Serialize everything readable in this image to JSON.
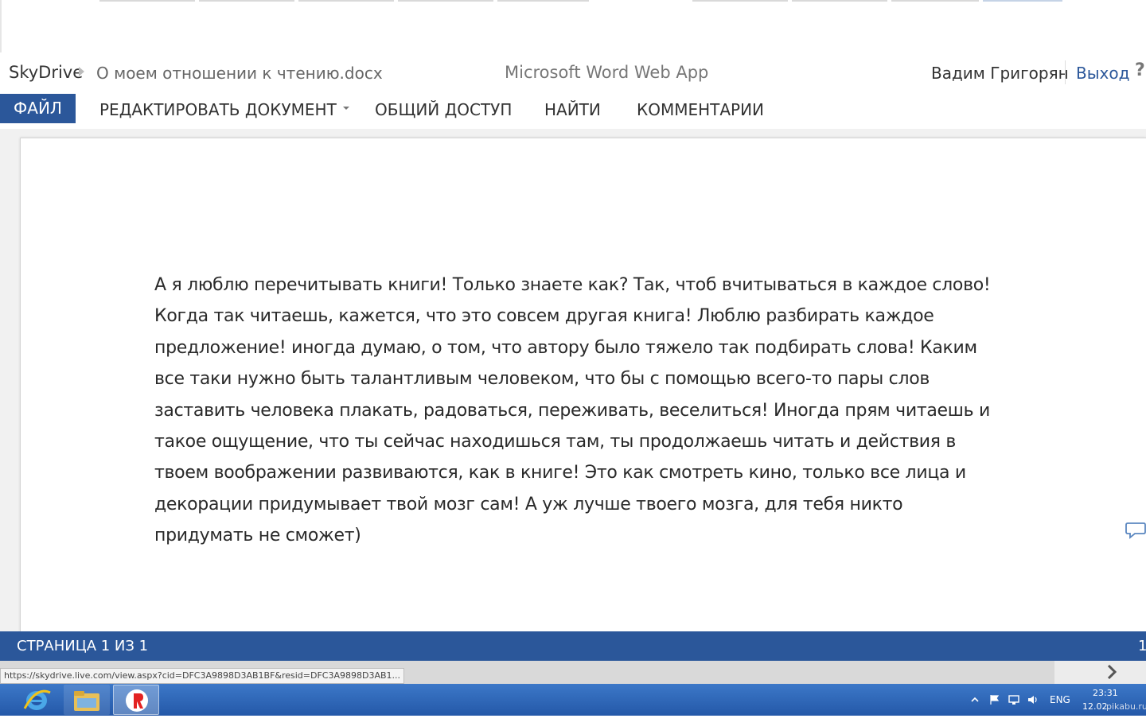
{
  "header": {
    "breadcrumb_root": "SkyDrive",
    "document_name": "О моем отношении к чтению.docx",
    "app_name": "Microsoft Word Web App",
    "user_name": "Вадим Григорян",
    "sign_out": "Выход",
    "help": "?"
  },
  "ribbon": {
    "tabs": [
      {
        "label": "ФАЙЛ"
      },
      {
        "label": "РЕДАКТИРОВАТЬ ДОКУМЕНТ"
      },
      {
        "label": "ОБЩИЙ ДОСТУП"
      },
      {
        "label": "НАЙТИ"
      },
      {
        "label": "КОММЕНТАРИИ"
      }
    ]
  },
  "document": {
    "lines": [
      "А я люблю перечитывать книги! Только знаете как? Так, чтоб вчитываться в каждое слово!",
      "Когда так читаешь, кажется, что это совсем другая книга! Люблю разбирать каждое",
      "предложение! иногда думаю, о том, что автору  было тяжело так подбирать слова! Каким",
      "все таки  нужно быть талантливым человеком, что бы с помощью всего-то пары слов",
      "заставить человека плакать, радоваться, переживать, веселиться! Иногда прям читаешь и",
      "такое ощущение, что ты сейчас находишься там, ты продолжаешь читать и действия в",
      "твоем воображении развиваются, как в книге! Это как смотреть кино, только  все лица и",
      "декорации придумывает твой мозг сам! А уж лучше твоего мозга, для тебя никто",
      "придумать не сможет)"
    ]
  },
  "status_bar": {
    "page_count": "СТРАНИЦА 1 ИЗ 1",
    "right_value": "1"
  },
  "browser": {
    "status_url": "https://skydrive.live.com/view.aspx?cid=DFC3A9898D3AB1BF&resid=DFC3A9898D3AB1..."
  },
  "taskbar": {
    "language": "ENG",
    "time": "23:31",
    "date": "12.02.",
    "watermark": "pikabu.ru"
  },
  "colors": {
    "accent": "#2b579a",
    "taskbar": "#2d63b4"
  }
}
